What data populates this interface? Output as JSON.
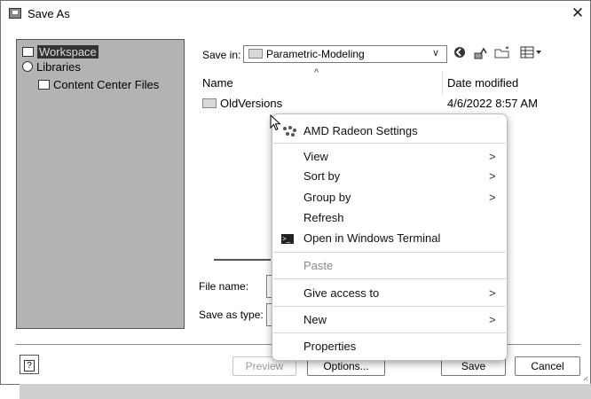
{
  "window": {
    "title": "Save As",
    "close_glyph": "✕"
  },
  "left_panel": {
    "items": [
      {
        "label": "Workspace",
        "icon": "workspace-icon",
        "selected": true
      },
      {
        "label": "Libraries",
        "icon": "libraries-icon"
      },
      {
        "label": "Content Center Files",
        "icon": "folder-icon"
      }
    ]
  },
  "save_in": {
    "label": "Save in:",
    "value": "Parametric-Modeling",
    "toolbar_icons": [
      "back-icon",
      "up-folder-icon",
      "new-folder-icon",
      "view-menu-icon"
    ]
  },
  "file_list": {
    "columns": [
      "Name",
      "Date modified"
    ],
    "sort_indicator": "^",
    "rows": [
      {
        "name": "OldVersions",
        "date": "4/6/2022 8:57 AM"
      }
    ]
  },
  "file_name": {
    "label": "File name:",
    "value": ""
  },
  "save_as_type": {
    "label": "Save as type:",
    "value": ""
  },
  "buttons": {
    "help": "?",
    "preview": "Preview",
    "options": "Options...",
    "save": "Save",
    "cancel": "Cancel"
  },
  "context_menu": {
    "items": [
      {
        "label": "AMD Radeon Settings",
        "icon": "amd-radeon-icon"
      },
      {
        "label": "View",
        "submenu": true
      },
      {
        "label": "Sort by",
        "submenu": true
      },
      {
        "label": "Group by",
        "submenu": true
      },
      {
        "label": "Refresh"
      },
      {
        "label": "Open in Windows Terminal",
        "icon": "terminal-icon"
      },
      {
        "label": "Paste",
        "disabled": true
      },
      {
        "label": "Give access to",
        "submenu": true
      },
      {
        "label": "New",
        "submenu": true
      },
      {
        "label": "Properties"
      }
    ],
    "submenu_glyph": ">"
  }
}
